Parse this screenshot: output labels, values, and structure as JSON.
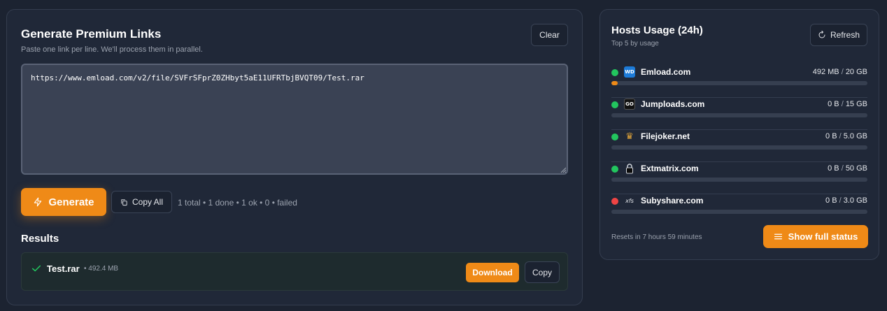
{
  "generator": {
    "title": "Generate Premium Links",
    "subtitle": "Paste one link per line. We'll process them in parallel.",
    "clear_label": "Clear",
    "textarea_value": "https://www.emload.com/v2/file/SVFrSFprZ0ZHbyt5aE11UFRTbjBVQT09/Test.rar",
    "generate_label": "Generate",
    "copy_all_label": "Copy All",
    "stats": "1 total • 1 done • 1 ok • 0 • failed"
  },
  "results": {
    "title": "Results",
    "items": [
      {
        "filename": "Test.rar",
        "size": "• 492.4 MB",
        "download_label": "Download",
        "copy_label": "Copy"
      }
    ]
  },
  "hosts": {
    "title": "Hosts Usage (24h)",
    "subtitle": "Top 5 by usage",
    "refresh_label": "Refresh",
    "items": [
      {
        "name": "Emload.com",
        "icon_text": "WD",
        "icon": "emload-logo-icon",
        "used": "492 MB",
        "limit": "20 GB",
        "fraction": 0.024,
        "status": "online",
        "status_color": "#22c55e"
      },
      {
        "name": "Jumploads.com",
        "icon_text": "GO",
        "icon": "jumploads-logo-icon",
        "used": "0 B",
        "limit": "15 GB",
        "fraction": 0,
        "status": "online",
        "status_color": "#22c55e"
      },
      {
        "name": "Filejoker.net",
        "icon_text": "♛",
        "icon": "filejoker-crown-icon",
        "used": "0 B",
        "limit": "5.0 GB",
        "fraction": 0,
        "status": "online",
        "status_color": "#22c55e"
      },
      {
        "name": "Extmatrix.com",
        "icon_text": "",
        "icon": "extmatrix-lock-icon",
        "used": "0 B",
        "limit": "50 GB",
        "fraction": 0,
        "status": "online",
        "status_color": "#22c55e"
      },
      {
        "name": "Subyshare.com",
        "icon_text": "xfs",
        "icon": "subyshare-logo-icon",
        "used": "0 B",
        "limit": "3.0 GB",
        "fraction": 0,
        "status": "offline",
        "status_color": "#ef4444"
      }
    ],
    "separator": "/",
    "resets_text": "Resets in 7 hours 59 minutes",
    "show_full_status_label": "Show full status"
  },
  "colors": {
    "accent": "#ef8a17",
    "online": "#22c55e",
    "offline": "#ef4444",
    "background": "#1c2331",
    "card": "#202838"
  }
}
